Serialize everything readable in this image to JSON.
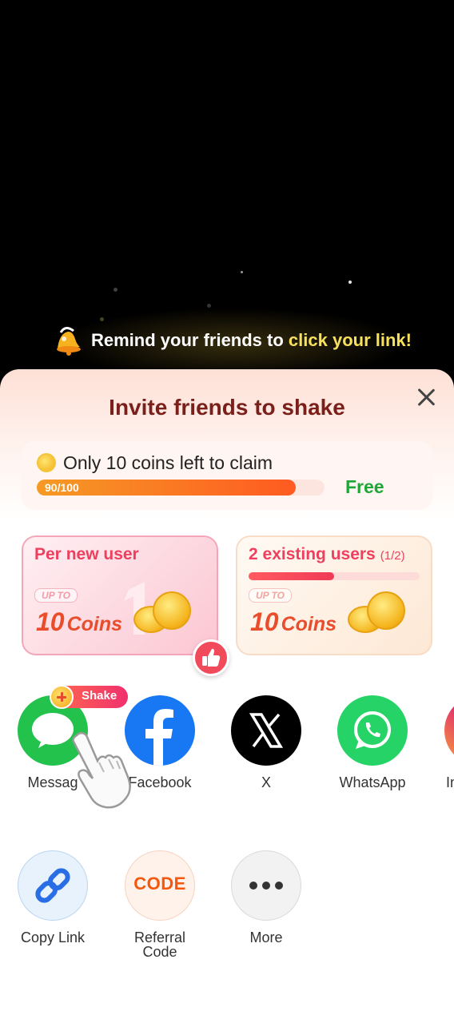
{
  "banner": {
    "text_plain": "Remind your friends to ",
    "text_highlight": "click your link!",
    "highlight_color": "#f7e15a",
    "icon": "bell-icon"
  },
  "sheet": {
    "title": "Invite friends to shake",
    "close_icon": "close-icon",
    "progress": {
      "title": "Only 10 coins left to claim",
      "value_text": "90/100",
      "fraction": 0.9,
      "status": "Free",
      "status_color": "#1fa637"
    },
    "rewards": [
      {
        "title": "Per new user",
        "sub": "",
        "upto": "UP TO",
        "amount": "10",
        "unit": "Coins"
      },
      {
        "title": "2 existing users",
        "sub": "(1/2)",
        "upto": "UP TO",
        "amount": "10",
        "unit": "Coins",
        "fraction": 0.5
      }
    ],
    "shake_badge": "Shake",
    "share_apps": [
      {
        "label": "Messag",
        "icon": "message-icon"
      },
      {
        "label": "Facebook",
        "icon": "facebook-icon"
      },
      {
        "label": "X",
        "icon": "x-icon"
      },
      {
        "label": "WhatsApp",
        "icon": "whatsapp-icon"
      },
      {
        "label": "In",
        "icon": "instagram-icon"
      }
    ],
    "actions": [
      {
        "label": "Copy Link",
        "icon": "link-icon"
      },
      {
        "label": "Referral Code",
        "icon": "code-icon",
        "icon_text": "CODE"
      },
      {
        "label": "More",
        "icon": "more-icon"
      }
    ]
  }
}
